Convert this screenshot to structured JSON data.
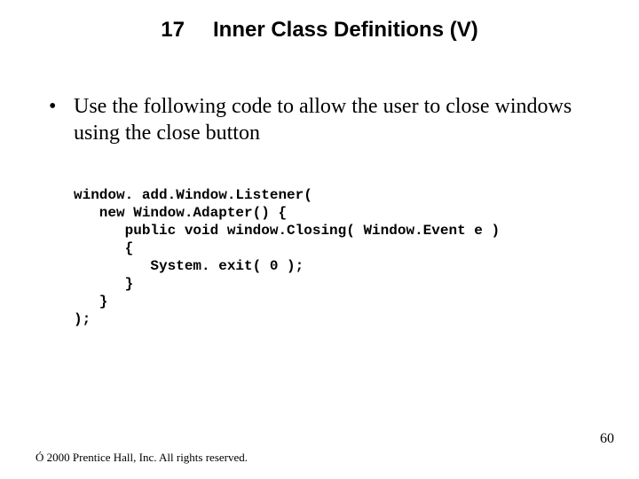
{
  "title": {
    "number": "17",
    "text": "Inner Class Definitions (V)"
  },
  "bullet": {
    "marker": "•",
    "text": "Use the following code to allow the user to close windows using the close button"
  },
  "code": "window. add.Window.Listener(\n   new Window.Adapter() {\n      public void window.Closing( Window.Event e )\n      {\n         System. exit( 0 );\n      }\n   }\n);",
  "footer": {
    "symbol": "Ó",
    "text": " 2000 Prentice Hall, Inc. All rights reserved."
  },
  "page_number": "60"
}
